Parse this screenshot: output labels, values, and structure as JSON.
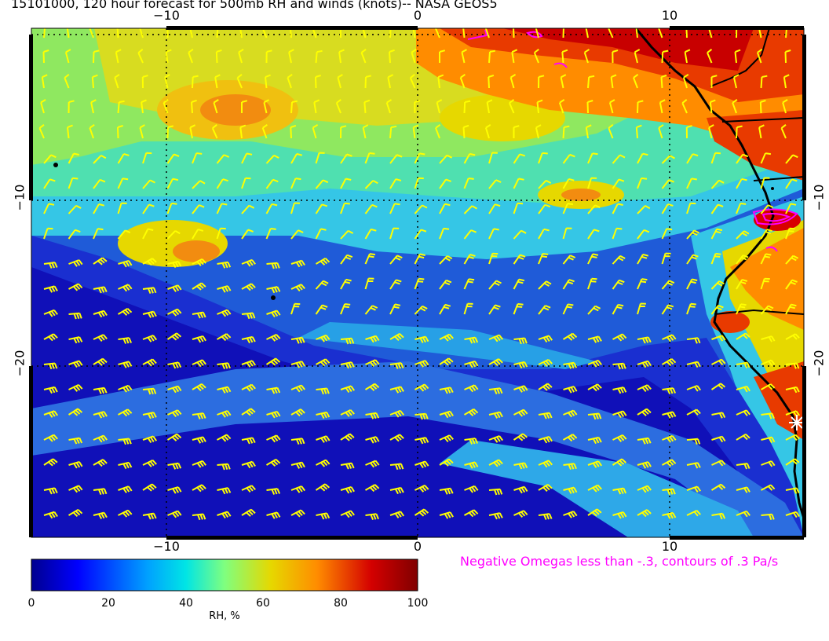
{
  "title": "15101000, 120 hour forecast for 500mb RH and winds (knots)-- NASA GEOS5",
  "lon_ticks": [
    "−10",
    "0",
    "10"
  ],
  "lat_ticks": [
    "−10",
    "−20"
  ],
  "colorbar": {
    "ticks": [
      "0",
      "20",
      "40",
      "60",
      "80",
      "100"
    ],
    "label": "RH, %",
    "range": [
      0,
      100
    ],
    "colormap": [
      "#00008f",
      "#0000ff",
      "#00bfff",
      "#7fff7f",
      "#e6d800",
      "#ff7f00",
      "#d00000",
      "#800000"
    ]
  },
  "omega_note": {
    "text": "Negative Omegas less than -.3, contours of .3 Pa/s",
    "color": "#ff00ff"
  },
  "barb_color": "#ffff00",
  "coast_color": "#000000"
}
